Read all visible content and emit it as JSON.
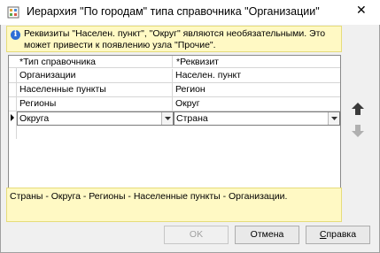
{
  "window": {
    "title": "Иерархия \"По городам\" типа справочника \"Организации\"",
    "close_glyph": "✕"
  },
  "info": {
    "icon": "info-icon",
    "text": "Реквизиты \"Населен. пункт\", \"Округ\" являются необязательными. Это может привести к появлению узла \"Прочие\"."
  },
  "grid": {
    "columns": [
      "*Тип справочника",
      "*Реквизит"
    ],
    "rows": [
      {
        "type": "Организации",
        "attr": "Населен. пункт"
      },
      {
        "type": "Населенные пункты",
        "attr": "Регион"
      },
      {
        "type": "Регионы",
        "attr": "Округ"
      },
      {
        "type": "Округа",
        "attr": "Страна",
        "editing": true
      }
    ]
  },
  "side_buttons": {
    "up": "arrow-up-icon",
    "down": "arrow-down-icon"
  },
  "path": {
    "text": "Страны - Округа - Регионы - Населенные пункты - Организации."
  },
  "buttons": {
    "ok": "OK",
    "cancel": "Отмена",
    "help_first": "С",
    "help_rest": "правка"
  },
  "colors": {
    "info_bg": "#fff9c4",
    "accent_blue": "#2f6fd6"
  }
}
